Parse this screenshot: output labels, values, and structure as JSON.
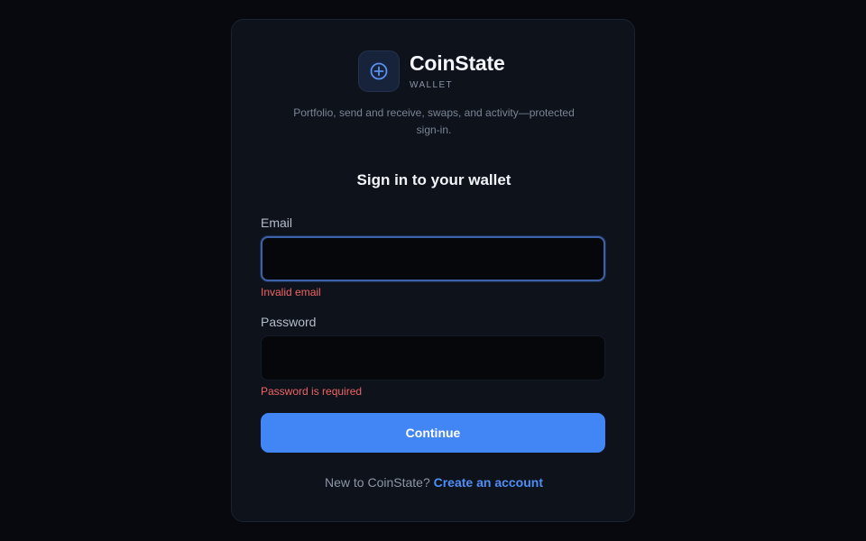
{
  "brand": {
    "name": "CoinState",
    "subtitle": "WALLET",
    "tagline": "Portfolio, send and receive, swaps, and activity—protected sign-in.",
    "logo_icon": "plus-circle-icon"
  },
  "form": {
    "heading": "Sign in to your wallet",
    "email": {
      "label": "Email",
      "value": "",
      "error": "Invalid email"
    },
    "password": {
      "label": "Password",
      "value": "",
      "error": "Password is required"
    },
    "submit_label": "Continue"
  },
  "footer": {
    "prompt": "New to CoinState?",
    "link_label": "Create an account"
  },
  "colors": {
    "background": "#07090f",
    "card": "#0d121b",
    "accent": "#4285f4",
    "error": "#f06464",
    "link": "#4f8ef7"
  }
}
